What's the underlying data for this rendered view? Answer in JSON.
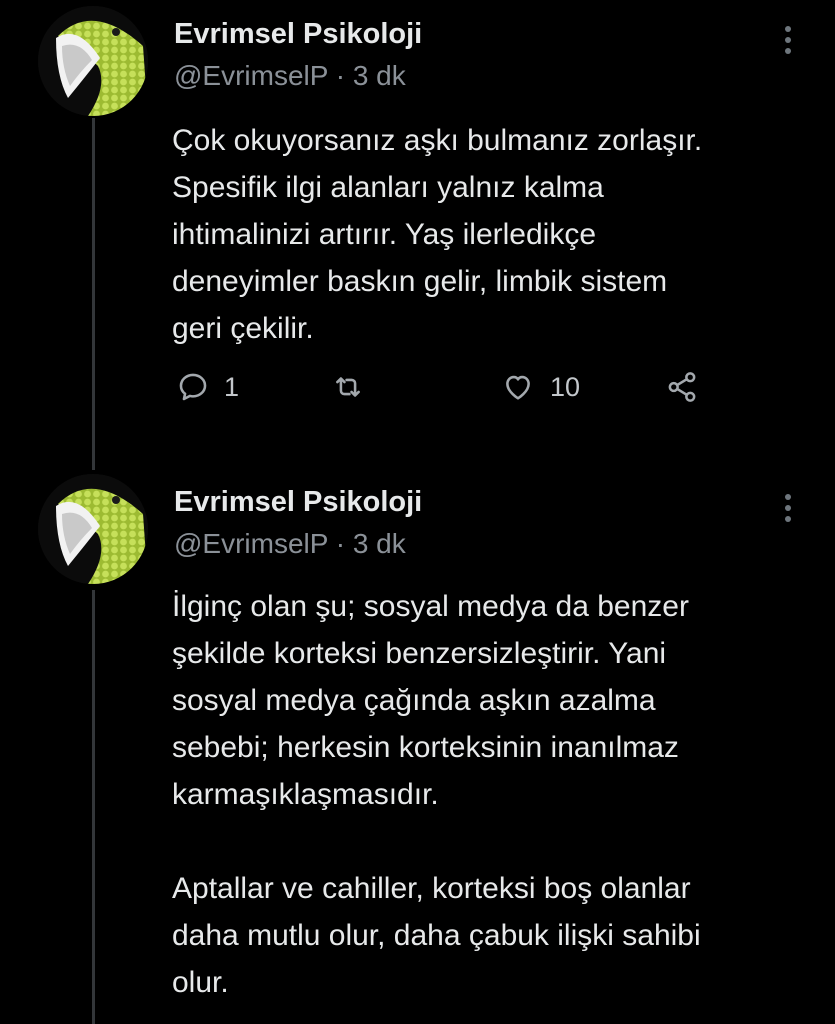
{
  "tweets": [
    {
      "name": "Evrimsel Psikoloji",
      "handle": "@EvrimselP",
      "time": "3 dk",
      "paragraphs": [
        "Çok okuyorsanız aşkı bulmanız zorlaşır.\nSpesifik ilgi alanları yalnız kalma\nihtimalinizi artırır. Yaş ilerledikçe\ndeneyimler baskın gelir, limbik sistem\ngeri çekilir."
      ],
      "replies": "1",
      "retweets": "",
      "likes": "10"
    },
    {
      "name": "Evrimsel Psikoloji",
      "handle": "@EvrimselP",
      "time": "3 dk",
      "paragraphs": [
        "İlginç olan şu; sosyal medya da benzer\nşekilde korteksi benzersizleştirir. Yani\nsosyal medya çağında aşkın azalma\nsebebi; herkesin korteksinin inanılmaz\nkarmaşıklaşmasıdır.",
        "Aptallar ve cahiller, korteksi boş olanlar\ndaha mutlu olur, daha çabuk ilişki sahibi\nolur."
      ]
    }
  ],
  "separator": "·",
  "icons": {
    "avatar": "snake-avatar",
    "more": "more-vertical-icon",
    "reply": "reply-icon",
    "retweet": "retweet-icon",
    "like": "heart-icon",
    "share": "share-icon"
  },
  "colors": {
    "background": "#000000",
    "text": "#e7e9ea",
    "secondary": "#8b9198",
    "thread_line": "#333639",
    "avatar_green": "#b8d84a"
  }
}
